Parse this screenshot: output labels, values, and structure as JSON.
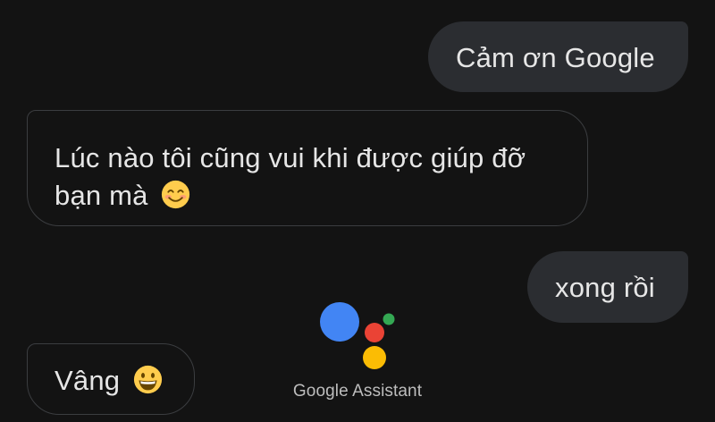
{
  "conversation": [
    {
      "role": "user",
      "text": "Cảm ơn Google"
    },
    {
      "role": "assistant",
      "text": "Lúc nào tôi cũng vui khi được giúp đỡ bạn mà",
      "emoji": "smiling-face-with-smiling-eyes"
    },
    {
      "role": "user",
      "text": "xong rồi"
    },
    {
      "role": "assistant",
      "text": "Vâng",
      "emoji": "grinning-face-with-big-eyes"
    }
  ],
  "branding": {
    "label": "Google Assistant",
    "logo_icon": "google-assistant-icon",
    "colors": {
      "blue": "#4285F4",
      "red": "#EA4335",
      "yellow": "#FBBC04",
      "green": "#34A853"
    }
  },
  "theme": {
    "background": "#131313",
    "user_bubble": "#2b2d31",
    "assistant_border": "#3b3d40",
    "text": "#e6e6e6"
  }
}
